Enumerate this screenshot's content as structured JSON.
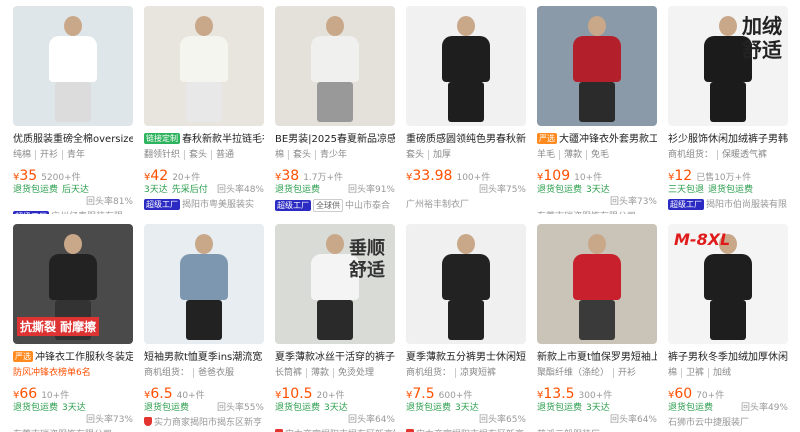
{
  "products": [
    {
      "title": "优质服装重磅全棉oversize",
      "title_red": "服装",
      "tags": [
        "纯棉",
        "开衫",
        "青年"
      ],
      "price": "35",
      "sold": "5200+件",
      "services": [
        "退货包运费",
        "后天达"
      ],
      "repurchase": "回头率81%",
      "factory": "超级工厂",
      "shop": "广州亿泰服装有限",
      "img_bg": "#dfe6ea"
    },
    {
      "badge": "链接定制",
      "title": "春秋新款半拉链毛衣",
      "tags": [
        "翻领针织",
        "套头",
        "普通"
      ],
      "price": "42",
      "sold": "20+件",
      "services": [
        "3天达",
        "先采后付"
      ],
      "repurchase": "回头率48%",
      "factory": "超级工厂",
      "shop": "揭阳市粤美服装实",
      "img_bg": "#e8e4de"
    },
    {
      "title": "BE男装|2025春夏新品凉感",
      "tags": [
        "棉",
        "套头",
        "青少年"
      ],
      "price": "38",
      "sold": "1.7万+件",
      "services": [
        "退货包运费"
      ],
      "repurchase": "回头率91%",
      "factory": "超级工厂",
      "badge2": "全球供",
      "shop": "中山市泰合",
      "img_bg": "#e4e1da"
    },
    {
      "title": "重磅质感圆领纯色男春秋新",
      "tags": [
        "套头",
        "加厚"
      ],
      "price": "33.98",
      "sold": "100+件",
      "services": [],
      "repurchase": "回头率75%",
      "shop": "广州裕丰制衣厂",
      "img_bg": "#f1f1f1"
    },
    {
      "badge": "严选",
      "title": "大疆冲锋衣外套男款工",
      "tags": [
        "羊毛",
        "薄款",
        "免毛"
      ],
      "price": "109",
      "sold": "10+件",
      "services": [
        "退货包运费",
        "3天达"
      ],
      "repurchase": "回头率73%",
      "shop": "东莞市瑞姿服饰有限公司",
      "img_bg": "#8a9aa8"
    },
    {
      "title": "衫少服饰休闲加绒裤子男韩",
      "tags": [
        "商机组货：",
        "保暖透气裤"
      ],
      "price": "12",
      "sold": "已售10万+件",
      "services": [
        "三天包退",
        "退货包运费"
      ],
      "repurchase": "",
      "factory": "超级工厂",
      "shop": "揭阳市伯尚服装有限",
      "img_bg": "#f3f3f3",
      "overlay": "加绒\n舒适"
    },
    {
      "badge": "严选",
      "title": "冲锋衣工作服秋冬装定",
      "tags_red": "防风冲锋衣榜单6名",
      "price": "66",
      "sold": "10+件",
      "services": [
        "退货包运费",
        "3天达"
      ],
      "repurchase": "回头率73%",
      "shop": "东莞市瑞姿服饰有限公司",
      "img_bg": "#4a4a4a",
      "overlay": "抗撕裂 耐摩擦"
    },
    {
      "title": "短袖男款t恤夏季ins潮流宽",
      "tags": [
        "商机组货：",
        "爸爸衣服"
      ],
      "price": "6.5",
      "sold": "40+件",
      "services": [
        "退货包运费"
      ],
      "repurchase": "回头率55%",
      "shield": "实力商家",
      "shop": "揭阳市揭东区新亨",
      "img_bg": "#e8edf1"
    },
    {
      "title": "夏季薄款冰丝干活穿的裤子",
      "tags": [
        "长筒裤",
        "薄款",
        "免烫处理"
      ],
      "price": "10.5",
      "sold": "20+件",
      "services": [
        "退货包运费",
        "3天达"
      ],
      "repurchase": "回头率64%",
      "shield": "实力商家",
      "shop": "揭阳市揭东区新亨镇源幸服",
      "img_bg": "#d9dbd7",
      "overlay": "垂顺\n舒适"
    },
    {
      "title": "夏季薄款五分裤男士休闲短",
      "tags": [
        "商机组货：",
        "凉爽短裤"
      ],
      "price": "7.5",
      "sold": "600+件",
      "services": [
        "退货包运费",
        "3天达"
      ],
      "repurchase": "回头率65%",
      "shield": "实力商家",
      "shop": "揭阳市揭东区新亨",
      "img_bg": "#f0f0f0"
    },
    {
      "title": "新款上市夏t恤保罗男短袖上",
      "tags": [
        "聚酯纤维（涤纶）",
        "开衫"
      ],
      "price": "13.5",
      "sold": "300+件",
      "services": [
        "退货包运费",
        "3天达"
      ],
      "repurchase": "回头率64%",
      "shop": "慈溪云毅服装厂",
      "img_bg": "#c9c3b8"
    },
    {
      "title": "裤子男秋冬季加绒加厚休闲裤",
      "tags": [
        "棉",
        "卫裤",
        "加绒"
      ],
      "price": "60",
      "sold": "70+件",
      "services": [
        "退货包运费"
      ],
      "repurchase": "回头率49%",
      "shop": "石狮市云中捷服装厂",
      "img_bg": "#f4f4f4",
      "overlay": "M-8XL"
    }
  ],
  "currency": "¥",
  "colors": {
    "price": "#ff5000",
    "service": "#2a9d4c",
    "factory_badge": "#2b2bc4",
    "shield": "#e3342f"
  }
}
